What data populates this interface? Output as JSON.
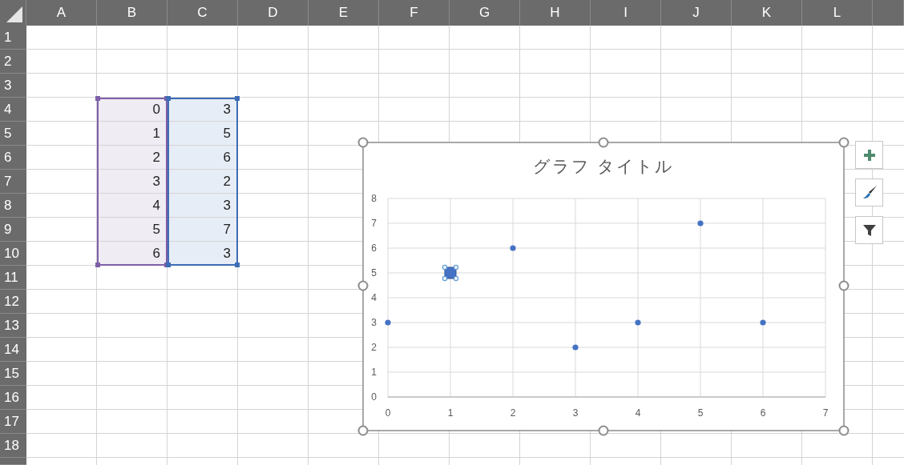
{
  "columns": [
    "A",
    "B",
    "C",
    "D",
    "E",
    "F",
    "G",
    "H",
    "I",
    "J",
    "K",
    "L"
  ],
  "rows": [
    "1",
    "2",
    "3",
    "4",
    "5",
    "6",
    "7",
    "8",
    "9",
    "10",
    "11",
    "12",
    "13",
    "14",
    "15",
    "16",
    "17",
    "18"
  ],
  "data_columns": [
    {
      "color": "#7f5fa8",
      "cells": [
        "0",
        "1",
        "2",
        "3",
        "4",
        "5",
        "6"
      ]
    },
    {
      "color": "#3d6db5",
      "cells": [
        "3",
        "5",
        "6",
        "2",
        "3",
        "7",
        "3"
      ]
    }
  ],
  "chart": {
    "selected": true,
    "chart_data": {
      "type": "scatter",
      "title": "グラフ タイトル",
      "x": [
        0,
        1,
        2,
        3,
        4,
        5,
        6
      ],
      "series": [
        {
          "color": "#4472c4",
          "values": [
            3,
            5,
            6,
            2,
            3,
            7,
            3
          ]
        }
      ],
      "grid": true,
      "xlim": [
        0,
        7
      ],
      "ylim": [
        0,
        8
      ],
      "xticks": [
        0,
        1,
        2,
        3,
        4,
        5,
        6,
        7
      ],
      "yticks": [
        0,
        1,
        2,
        3,
        4,
        5,
        6,
        7,
        8
      ]
    },
    "points": [
      {
        "selected": false
      },
      {
        "selected": true
      },
      {
        "selected": false
      },
      {
        "selected": false
      },
      {
        "selected": false
      },
      {
        "selected": false
      },
      {
        "selected": false
      }
    ],
    "tools": [
      {
        "kind": "add"
      },
      {
        "kind": "style"
      },
      {
        "kind": "filter"
      }
    ]
  }
}
